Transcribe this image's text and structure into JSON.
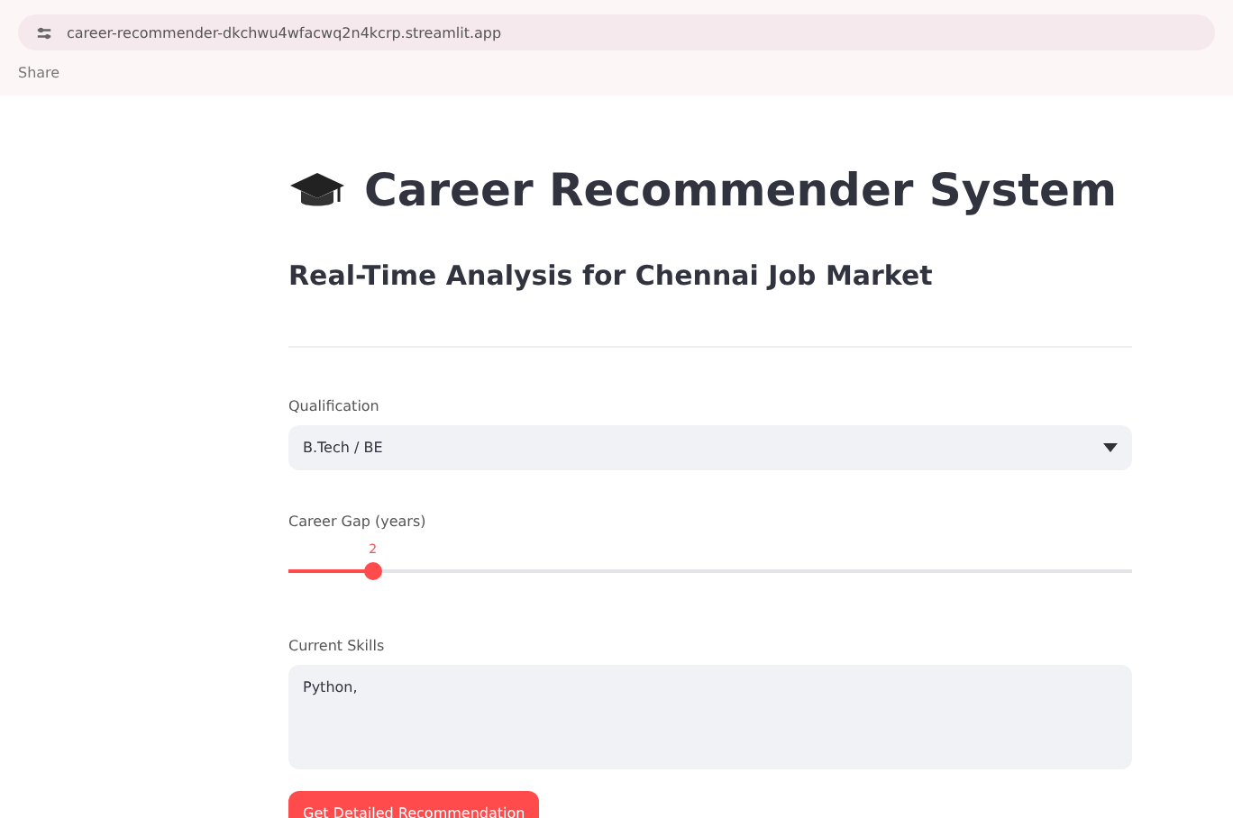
{
  "browser": {
    "url": "career-recommender-dkchwu4wfacwq2n4kcrp.streamlit.app",
    "toolbar_text": "Share"
  },
  "app": {
    "title": "Career Recommender System",
    "subtitle": "Real-Time Analysis for Chennai Job Market",
    "qualification": {
      "label": "Qualification",
      "value": "B.Tech / BE"
    },
    "career_gap": {
      "label": "Career Gap (years)",
      "reading": "2",
      "level": 0.1
    },
    "skills": {
      "label": "Current Skills",
      "value": "Python,"
    },
    "button": "Get Detailed Recommendation"
  }
}
